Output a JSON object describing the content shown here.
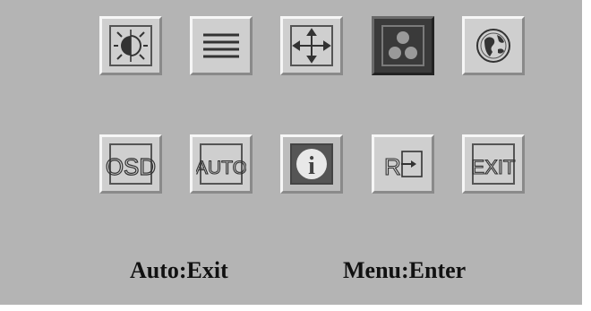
{
  "icons_row1": [
    {
      "id": "brightness",
      "icon": "brightness-contrast-icon"
    },
    {
      "id": "image-settings",
      "icon": "horizontal-lines-icon"
    },
    {
      "id": "position",
      "icon": "move-arrows-icon"
    },
    {
      "id": "color",
      "icon": "color-dots-icon"
    },
    {
      "id": "language",
      "icon": "globe-icon"
    }
  ],
  "icons_row2": [
    {
      "id": "osd-settings",
      "icon": "osd-icon",
      "text": "OSD"
    },
    {
      "id": "auto-adjust",
      "icon": "auto-icon",
      "text": "AUTO"
    },
    {
      "id": "information",
      "icon": "info-icon",
      "text": "i"
    },
    {
      "id": "reset",
      "icon": "reset-icon",
      "text": "R"
    },
    {
      "id": "exit",
      "icon": "exit-icon",
      "text": "EXIT"
    }
  ],
  "selected_item": "color",
  "footer": {
    "auto_hint": "Auto:Exit",
    "menu_hint": "Menu:Enter"
  },
  "colors": {
    "panel_bg": "#b4b4b4",
    "tile_bg": "#cfcfcf",
    "selected_tile_bg": "#3a3a3a"
  }
}
